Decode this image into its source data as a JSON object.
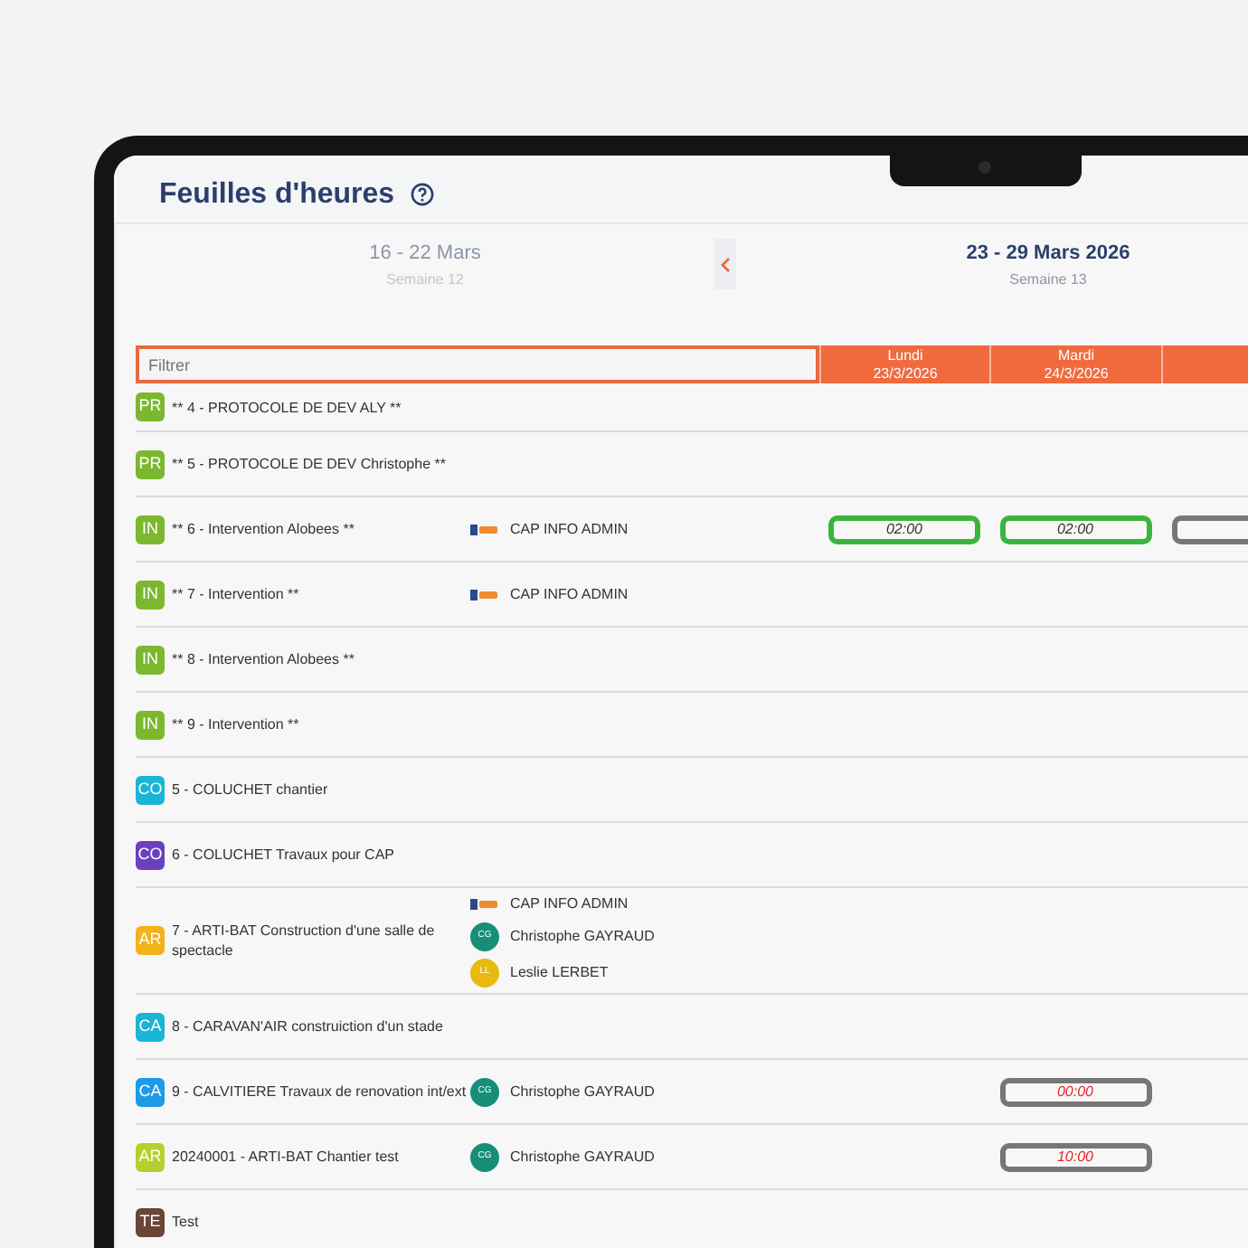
{
  "page": {
    "title": "Feuilles d'heures"
  },
  "weeks": [
    {
      "range": "16 - 22 Mars",
      "label": "Semaine 12",
      "current": false
    },
    {
      "range": "23 - 29 Mars 2026",
      "label": "Semaine 13",
      "current": true
    }
  ],
  "filter": {
    "placeholder": "Filtrer"
  },
  "day_columns": [
    {
      "day": "Lundi",
      "date": "23/3/2026"
    },
    {
      "day": "Mardi",
      "date": "24/3/2026"
    }
  ],
  "rows": [
    {
      "badge": "PR",
      "color": "#7cb82f",
      "title": "** 4 - PROTOCOLE DE DEV ALY **"
    },
    {
      "badge": "PR",
      "color": "#7cb82f",
      "title": "** 5 - PROTOCOLE DE DEV Christophe **"
    },
    {
      "badge": "IN",
      "color": "#7cb82f",
      "title": "** 6 - Intervention Alobees **",
      "assignees": [
        {
          "kind": "logo",
          "name": "CAP INFO ADMIN"
        }
      ],
      "hours": {
        "lundi": {
          "kind": "ok",
          "text": "02:00"
        },
        "mardi": {
          "kind": "ok",
          "text": "02:00"
        },
        "column_3": {
          "kind": "empty"
        }
      }
    },
    {
      "badge": "IN",
      "color": "#7cb82f",
      "title": "** 7 - Intervention **",
      "assignees": [
        {
          "kind": "logo",
          "name": "CAP INFO ADMIN"
        }
      ]
    },
    {
      "badge": "IN",
      "color": "#7cb82f",
      "title": "** 8 - Intervention Alobees **"
    },
    {
      "badge": "IN",
      "color": "#7cb82f",
      "title": "** 9 - Intervention **"
    },
    {
      "badge": "CO",
      "color": "#1ab4d6",
      "title": "5 - COLUCHET chantier"
    },
    {
      "badge": "CO",
      "color": "#6a3fc0",
      "title": "6 - COLUCHET Travaux pour CAP"
    },
    {
      "badge": "AR",
      "color": "#f2b21a",
      "title": "7 - ARTI-BAT Construction d'une salle de spectacle",
      "assignees": [
        {
          "kind": "logo",
          "name": "CAP INFO ADMIN"
        },
        {
          "kind": "avatar",
          "initials": "CG",
          "color": "#178f78",
          "name": "Christophe GAYRAUD"
        },
        {
          "kind": "avatar",
          "initials": "LL",
          "color": "#e8b90f",
          "name": "Leslie LERBET"
        }
      ]
    },
    {
      "badge": "CA",
      "color": "#1ab4d6",
      "title": "8 - CARAVAN'AIR construiction d'un stade"
    },
    {
      "badge": "CA",
      "color": "#1e9be6",
      "title": "9 - CALVITIERE Travaux de renovation int/ext",
      "assignees": [
        {
          "kind": "avatar",
          "initials": "CG",
          "color": "#178f78",
          "name": "Christophe GAYRAUD"
        }
      ],
      "hours": {
        "mardi": {
          "kind": "pending",
          "text": "00:00"
        }
      }
    },
    {
      "badge": "AR",
      "color": "#b5cf2e",
      "title": "20240001 - ARTI-BAT Chantier test",
      "assignees": [
        {
          "kind": "avatar",
          "initials": "CG",
          "color": "#178f78",
          "name": "Christophe GAYRAUD"
        }
      ],
      "hours": {
        "mardi": {
          "kind": "pending",
          "text": "10:00"
        }
      }
    },
    {
      "badge": "TE",
      "color": "#6b4538",
      "title": "Test"
    }
  ]
}
